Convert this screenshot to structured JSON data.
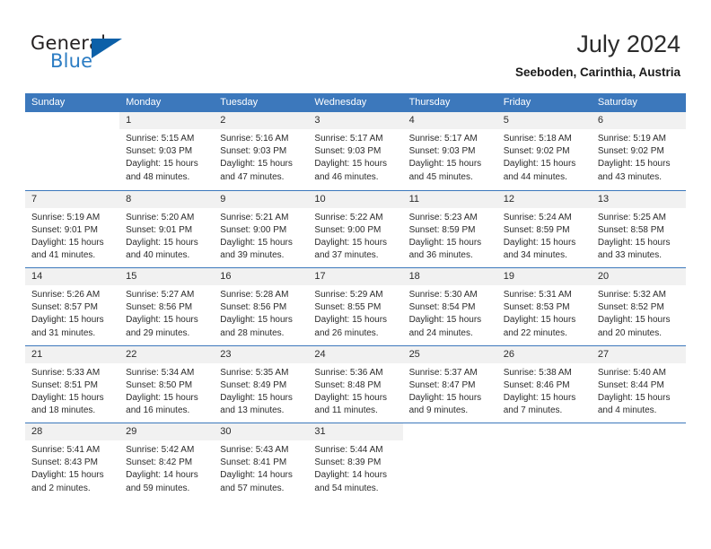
{
  "brand": {
    "name_part1": "General",
    "name_part2": "Blue",
    "logo_icon": "blue-triangle-icon",
    "accent_color": "#2b7cc3",
    "triangle_color": "#0c60a8"
  },
  "header": {
    "month_title": "July 2024",
    "location": "Seeboden, Carinthia, Austria"
  },
  "calendar": {
    "header_bg": "#3c78bc",
    "band_bg": "#f1f1f1",
    "weekdays": [
      "Sunday",
      "Monday",
      "Tuesday",
      "Wednesday",
      "Thursday",
      "Friday",
      "Saturday"
    ],
    "weeks": [
      [
        {
          "day": "",
          "lines": []
        },
        {
          "day": "1",
          "lines": [
            "Sunrise: 5:15 AM",
            "Sunset: 9:03 PM",
            "Daylight: 15 hours",
            "and 48 minutes."
          ]
        },
        {
          "day": "2",
          "lines": [
            "Sunrise: 5:16 AM",
            "Sunset: 9:03 PM",
            "Daylight: 15 hours",
            "and 47 minutes."
          ]
        },
        {
          "day": "3",
          "lines": [
            "Sunrise: 5:17 AM",
            "Sunset: 9:03 PM",
            "Daylight: 15 hours",
            "and 46 minutes."
          ]
        },
        {
          "day": "4",
          "lines": [
            "Sunrise: 5:17 AM",
            "Sunset: 9:03 PM",
            "Daylight: 15 hours",
            "and 45 minutes."
          ]
        },
        {
          "day": "5",
          "lines": [
            "Sunrise: 5:18 AM",
            "Sunset: 9:02 PM",
            "Daylight: 15 hours",
            "and 44 minutes."
          ]
        },
        {
          "day": "6",
          "lines": [
            "Sunrise: 5:19 AM",
            "Sunset: 9:02 PM",
            "Daylight: 15 hours",
            "and 43 minutes."
          ]
        }
      ],
      [
        {
          "day": "7",
          "lines": [
            "Sunrise: 5:19 AM",
            "Sunset: 9:01 PM",
            "Daylight: 15 hours",
            "and 41 minutes."
          ]
        },
        {
          "day": "8",
          "lines": [
            "Sunrise: 5:20 AM",
            "Sunset: 9:01 PM",
            "Daylight: 15 hours",
            "and 40 minutes."
          ]
        },
        {
          "day": "9",
          "lines": [
            "Sunrise: 5:21 AM",
            "Sunset: 9:00 PM",
            "Daylight: 15 hours",
            "and 39 minutes."
          ]
        },
        {
          "day": "10",
          "lines": [
            "Sunrise: 5:22 AM",
            "Sunset: 9:00 PM",
            "Daylight: 15 hours",
            "and 37 minutes."
          ]
        },
        {
          "day": "11",
          "lines": [
            "Sunrise: 5:23 AM",
            "Sunset: 8:59 PM",
            "Daylight: 15 hours",
            "and 36 minutes."
          ]
        },
        {
          "day": "12",
          "lines": [
            "Sunrise: 5:24 AM",
            "Sunset: 8:59 PM",
            "Daylight: 15 hours",
            "and 34 minutes."
          ]
        },
        {
          "day": "13",
          "lines": [
            "Sunrise: 5:25 AM",
            "Sunset: 8:58 PM",
            "Daylight: 15 hours",
            "and 33 minutes."
          ]
        }
      ],
      [
        {
          "day": "14",
          "lines": [
            "Sunrise: 5:26 AM",
            "Sunset: 8:57 PM",
            "Daylight: 15 hours",
            "and 31 minutes."
          ]
        },
        {
          "day": "15",
          "lines": [
            "Sunrise: 5:27 AM",
            "Sunset: 8:56 PM",
            "Daylight: 15 hours",
            "and 29 minutes."
          ]
        },
        {
          "day": "16",
          "lines": [
            "Sunrise: 5:28 AM",
            "Sunset: 8:56 PM",
            "Daylight: 15 hours",
            "and 28 minutes."
          ]
        },
        {
          "day": "17",
          "lines": [
            "Sunrise: 5:29 AM",
            "Sunset: 8:55 PM",
            "Daylight: 15 hours",
            "and 26 minutes."
          ]
        },
        {
          "day": "18",
          "lines": [
            "Sunrise: 5:30 AM",
            "Sunset: 8:54 PM",
            "Daylight: 15 hours",
            "and 24 minutes."
          ]
        },
        {
          "day": "19",
          "lines": [
            "Sunrise: 5:31 AM",
            "Sunset: 8:53 PM",
            "Daylight: 15 hours",
            "and 22 minutes."
          ]
        },
        {
          "day": "20",
          "lines": [
            "Sunrise: 5:32 AM",
            "Sunset: 8:52 PM",
            "Daylight: 15 hours",
            "and 20 minutes."
          ]
        }
      ],
      [
        {
          "day": "21",
          "lines": [
            "Sunrise: 5:33 AM",
            "Sunset: 8:51 PM",
            "Daylight: 15 hours",
            "and 18 minutes."
          ]
        },
        {
          "day": "22",
          "lines": [
            "Sunrise: 5:34 AM",
            "Sunset: 8:50 PM",
            "Daylight: 15 hours",
            "and 16 minutes."
          ]
        },
        {
          "day": "23",
          "lines": [
            "Sunrise: 5:35 AM",
            "Sunset: 8:49 PM",
            "Daylight: 15 hours",
            "and 13 minutes."
          ]
        },
        {
          "day": "24",
          "lines": [
            "Sunrise: 5:36 AM",
            "Sunset: 8:48 PM",
            "Daylight: 15 hours",
            "and 11 minutes."
          ]
        },
        {
          "day": "25",
          "lines": [
            "Sunrise: 5:37 AM",
            "Sunset: 8:47 PM",
            "Daylight: 15 hours",
            "and 9 minutes."
          ]
        },
        {
          "day": "26",
          "lines": [
            "Sunrise: 5:38 AM",
            "Sunset: 8:46 PM",
            "Daylight: 15 hours",
            "and 7 minutes."
          ]
        },
        {
          "day": "27",
          "lines": [
            "Sunrise: 5:40 AM",
            "Sunset: 8:44 PM",
            "Daylight: 15 hours",
            "and 4 minutes."
          ]
        }
      ],
      [
        {
          "day": "28",
          "lines": [
            "Sunrise: 5:41 AM",
            "Sunset: 8:43 PM",
            "Daylight: 15 hours",
            "and 2 minutes."
          ]
        },
        {
          "day": "29",
          "lines": [
            "Sunrise: 5:42 AM",
            "Sunset: 8:42 PM",
            "Daylight: 14 hours",
            "and 59 minutes."
          ]
        },
        {
          "day": "30",
          "lines": [
            "Sunrise: 5:43 AM",
            "Sunset: 8:41 PM",
            "Daylight: 14 hours",
            "and 57 minutes."
          ]
        },
        {
          "day": "31",
          "lines": [
            "Sunrise: 5:44 AM",
            "Sunset: 8:39 PM",
            "Daylight: 14 hours",
            "and 54 minutes."
          ]
        },
        {
          "day": "",
          "lines": []
        },
        {
          "day": "",
          "lines": []
        },
        {
          "day": "",
          "lines": []
        }
      ]
    ]
  }
}
